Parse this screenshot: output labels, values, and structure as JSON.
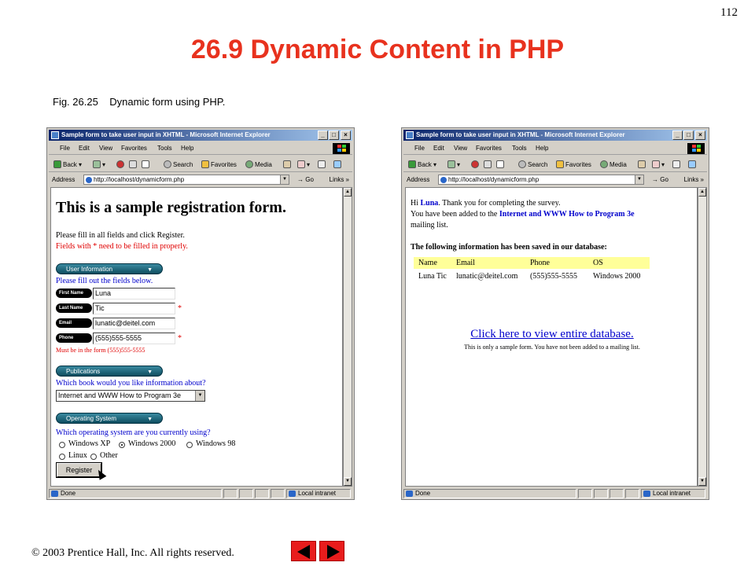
{
  "slide": {
    "page_number": "112",
    "title": "26.9 Dynamic Content in PHP",
    "caption": "Fig. 26.25    Dynamic form using PHP.",
    "copyright": "© 2003 Prentice Hall, Inc.  All rights reserved."
  },
  "browser": {
    "title": "Sample form to take user input in XHTML - Microsoft Internet Explorer",
    "menu": [
      "File",
      "Edit",
      "View",
      "Favorites",
      "Tools",
      "Help"
    ],
    "toolbar": {
      "back": "Back",
      "search": "Search",
      "favorites": "Favorites",
      "media": "Media"
    },
    "address_label": "Address",
    "address_url": "http://localhost/dynamicform.php",
    "go": "Go",
    "links": "Links",
    "status_left": "Done",
    "status_right": "Local intranet",
    "window_buttons": {
      "minimize": "_",
      "maximize": "□",
      "close": "×"
    }
  },
  "form_page": {
    "heading": "This is a sample registration form.",
    "instructions": "Please fill in all fields and click Register.",
    "required_note": "Fields with * need to be filled in properly.",
    "user_info_section": "User Information",
    "user_info_prompt": "Please fill out the fields below.",
    "fields": [
      {
        "label": "First Name",
        "value": "Luna",
        "required": ""
      },
      {
        "label": "Last Name",
        "value": "Tic",
        "required": "*"
      },
      {
        "label": "Email",
        "value": "lunatic@deitel.com",
        "required": ""
      },
      {
        "label": "Phone",
        "value": "(555)555-5555",
        "required": "*"
      }
    ],
    "phone_hint": "Must be in the form (555)555-5555",
    "publications_section": "Publications",
    "publications_prompt": "Which book would you like information about?",
    "book_selected": "Internet and WWW How to Program 3e",
    "os_section": "Operating System",
    "os_prompt": "Which operating system are you currently using?",
    "os_options": [
      {
        "label": "Windows XP",
        "checked": false
      },
      {
        "label": "Windows 2000",
        "checked": true
      },
      {
        "label": "Windows 98",
        "checked": false
      },
      {
        "label": "Linux",
        "checked": false
      },
      {
        "label": "Other",
        "checked": false
      }
    ],
    "register_button": "Register"
  },
  "result_page": {
    "greeting_hi": "Hi ",
    "greeting_name": "Luna",
    "greeting_rest": ". Thank you for completing the survey.",
    "added_prefix": "You have been added to the ",
    "added_book": "Internet and WWW How to Program 3e",
    "added_suffix": "mailing list.",
    "saved_heading": "The following information has been saved in our database:",
    "table_headers": [
      "Name",
      "Email",
      "Phone",
      "OS"
    ],
    "table_row": [
      "Luna Tic",
      "lunatic@deitel.com",
      "(555)555-5555",
      "Windows 2000"
    ],
    "db_link": "Click here to view entire database.",
    "sample_note": "This is only a sample form. You have not been added to a mailing list."
  },
  "colors": {
    "title_red": "#e8321e",
    "link_blue": "#0000cc",
    "header_yellow": "#ffff99",
    "section_teal": "#1a6478"
  }
}
